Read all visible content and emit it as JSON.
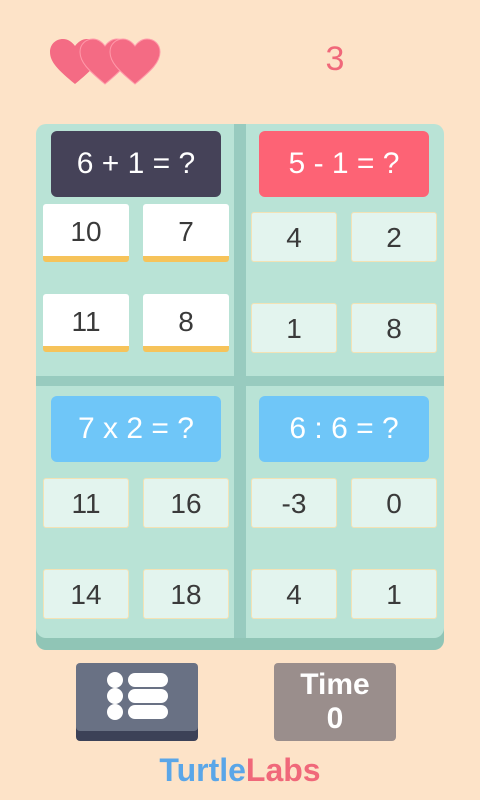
{
  "lives": {
    "count": 3,
    "color": "#f46b84",
    "icon": "heart-icon"
  },
  "score": "3",
  "colors": {
    "background": "#fde3c8",
    "board": "#b9e3d6",
    "question_dark": "#454258",
    "question_red": "#fd6375",
    "question_blue": "#6fc6f8",
    "answer_highlight": "#f6c35a"
  },
  "quadrants": [
    {
      "question": "6 + 1 = ?",
      "question_color": "#454258",
      "active": true,
      "answers": [
        "10",
        "7",
        "11",
        "8"
      ]
    },
    {
      "question": "5 - 1 = ?",
      "question_color": "#fd6375",
      "active": false,
      "answers": [
        "4",
        "2",
        "1",
        "8"
      ]
    },
    {
      "question": "7 x 2 = ?",
      "question_color": "#6fc6f8",
      "active": false,
      "answers": [
        "11",
        "16",
        "14",
        "18"
      ]
    },
    {
      "question": "6 : 6 = ?",
      "question_color": "#6fc6f8",
      "active": false,
      "answers": [
        "-3",
        "0",
        "4",
        "1"
      ]
    }
  ],
  "menu_button": {
    "icon": "list-icon"
  },
  "time": {
    "label": "Time",
    "value": "0"
  },
  "brand": {
    "part1": "Turtle",
    "part2": "Labs"
  }
}
